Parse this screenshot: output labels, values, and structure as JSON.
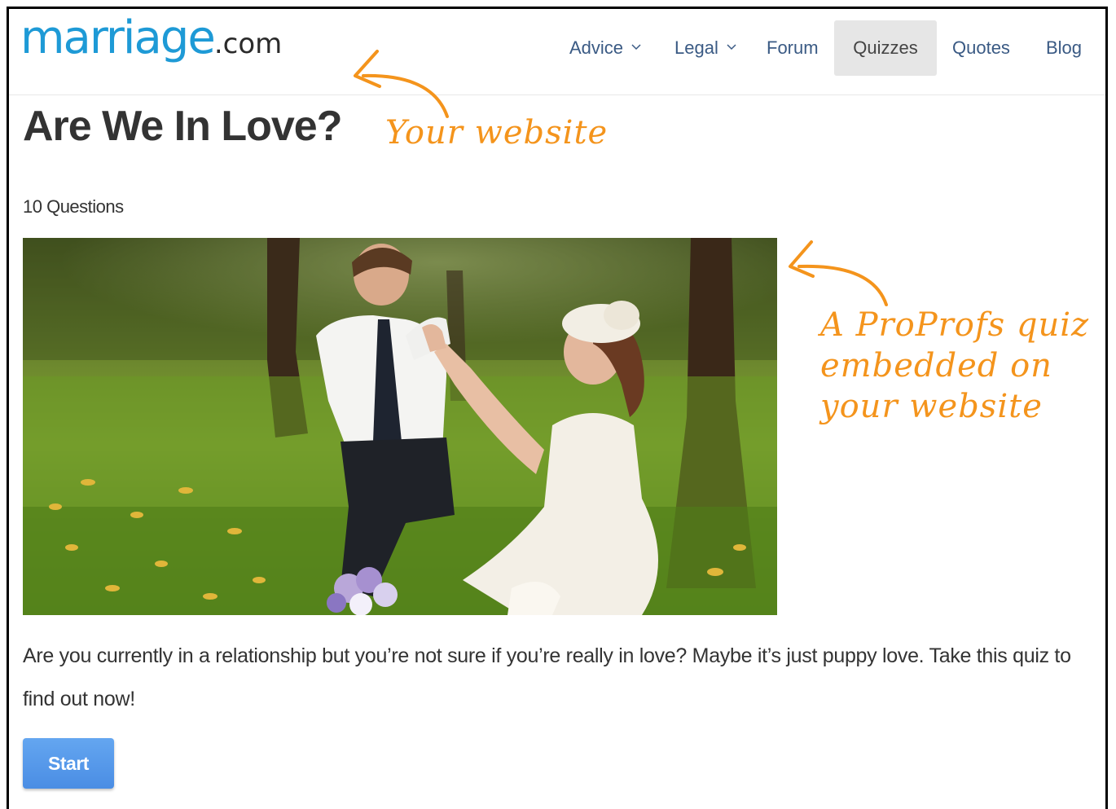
{
  "header": {
    "logo_word": "marriage",
    "logo_tld": ".com",
    "nav": [
      {
        "label": "Advice",
        "dropdown": true
      },
      {
        "label": "Legal",
        "dropdown": true
      },
      {
        "label": "Forum",
        "dropdown": false
      },
      {
        "label": "Quizzes",
        "dropdown": false,
        "active": true
      },
      {
        "label": "Quotes",
        "dropdown": false
      },
      {
        "label": "Blog",
        "dropdown": false
      }
    ]
  },
  "quiz": {
    "title": "Are We In Love?",
    "question_count": "10 Questions",
    "description": "Are you currently in a relationship but you’re not sure if you’re really in love? Maybe it’s just puppy love. Take this quiz to find out now!",
    "start_label": "Start"
  },
  "annotations": {
    "website_note": "Your website",
    "quiz_note": "A ProProfs quiz\nembedded on\nyour website"
  },
  "colors": {
    "brand": "#1e9ad6",
    "nav_link": "#3a5a84",
    "annotation": "#f4941c",
    "button": "#4a8de4"
  }
}
